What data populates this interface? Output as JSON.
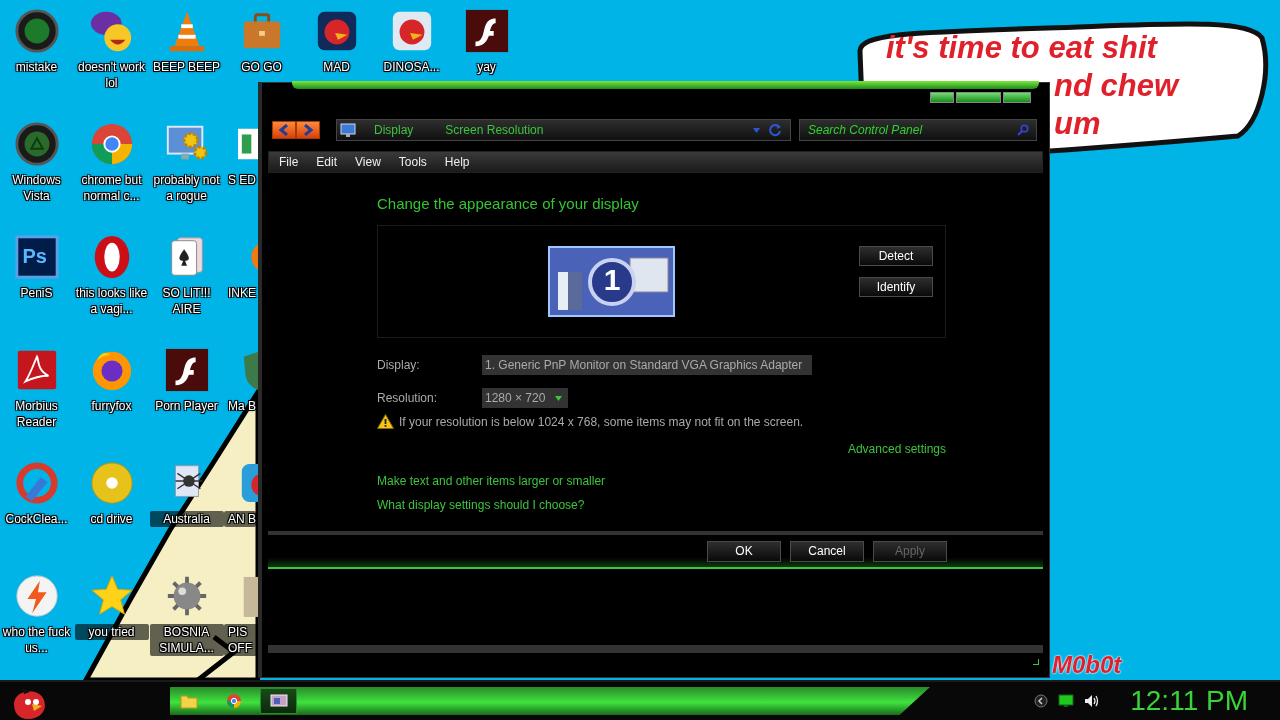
{
  "desktop": {
    "columns": [
      {
        "icons": [
          {
            "label": "mistake"
          },
          {
            "label": "Windows Vista"
          },
          {
            "label": "PeniS",
            "badge_text": "Ps"
          },
          {
            "label": "Morbius Reader"
          },
          {
            "label": "CockClea..."
          },
          {
            "label": "who the fuck us..."
          }
        ]
      },
      {
        "icons": [
          {
            "label": "doesn't work lol"
          },
          {
            "label": "chrome but normal c..."
          },
          {
            "label": "this looks like a vagi..."
          },
          {
            "label": "furryfox"
          },
          {
            "label": "cd drive"
          },
          {
            "label": "you tried"
          }
        ]
      },
      {
        "icons": [
          {
            "label": "BEEP BEEP"
          },
          {
            "label": "probably not a rogue"
          },
          {
            "label": "SO LIT!!! AIRE"
          },
          {
            "label": "Porn Player"
          },
          {
            "label": "Australia"
          },
          {
            "label": "BOSNIA SIMULA..."
          }
        ]
      },
      {
        "icons": [
          {
            "label": "GO GO"
          },
          {
            "label": "S ED"
          },
          {
            "label": "INKE"
          },
          {
            "label": "Ma B"
          },
          {
            "label": "AN B"
          },
          {
            "label": "PIS OFF"
          }
        ]
      },
      {
        "icons": [
          {
            "label": "MAD"
          }
        ]
      },
      {
        "icons": [
          {
            "label": "DINOSA..."
          }
        ]
      },
      {
        "icons": [
          {
            "label": "yay"
          }
        ]
      }
    ],
    "bubble": {
      "lines": [
        "it's time to eat shit",
        "nd chew",
        "um"
      ]
    },
    "signature": "M0b0t"
  },
  "window": {
    "breadcrumbs": [
      "Display",
      "Screen Resolution"
    ],
    "search": {
      "placeholder": "Search Control Panel"
    },
    "menu": [
      "File",
      "Edit",
      "View",
      "Tools",
      "Help"
    ],
    "heading": "Change the appearance of your display",
    "monitor": {
      "label": "1"
    },
    "side_buttons": [
      "Detect",
      "Identify"
    ],
    "fields": [
      {
        "label": "Display:",
        "value": "1. Generic PnP Monitor on Standard VGA Graphics Adapter"
      },
      {
        "label": "Resolution:",
        "value": "1280 × 720"
      }
    ],
    "warning": "If your resolution is below 1024 x 768, some items may not fit on the screen.",
    "advanced_link": "Advanced settings",
    "links": [
      "Make text and other items larger or smaller",
      "What display settings should I choose?"
    ],
    "buttons": [
      {
        "label": "OK",
        "disabled": false
      },
      {
        "label": "Cancel",
        "disabled": false
      },
      {
        "label": "Apply",
        "disabled": true
      }
    ]
  },
  "taskbar": {
    "items": [
      {
        "selected": false
      },
      {
        "selected": false
      },
      {
        "selected": true
      }
    ],
    "clock": "12:11 PM"
  }
}
